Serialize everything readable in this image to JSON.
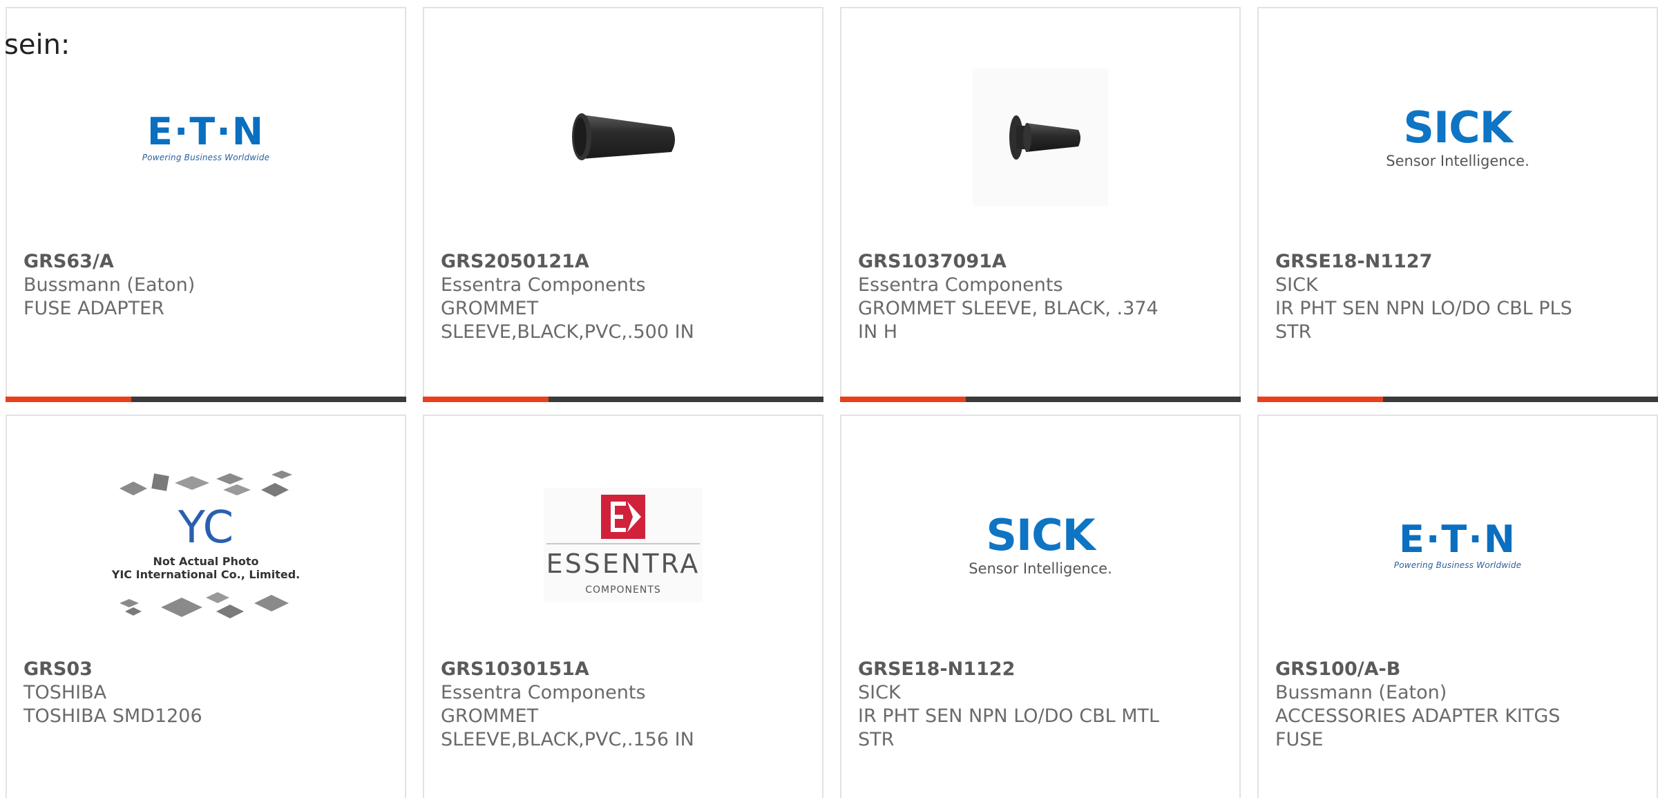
{
  "intro_text": "sein:",
  "colors": {
    "accent": "#e8401c",
    "bar": "#3b3b3b",
    "eaton_blue": "#0a6fc0",
    "sick_blue": "#0e74c4",
    "essentra_red": "#d0223a"
  },
  "products": [
    {
      "part": "GRS63/A",
      "manufacturer": "Bussmann (Eaton)",
      "description": "FUSE ADAPTER",
      "image": "eaton-logo",
      "logo": {
        "word": "E·T·N",
        "tag": "Powering Business Worldwide"
      }
    },
    {
      "part": "GRS2050121A",
      "manufacturer": "Essentra Components",
      "description_lines": [
        "GROMMET",
        "SLEEVE,BLACK,PVC,.500 IN"
      ],
      "image": "grommet-sleeve-photo"
    },
    {
      "part": "GRS1037091A",
      "manufacturer": "Essentra Components",
      "description_lines": [
        "GROMMET SLEEVE, BLACK, .374",
        "IN H"
      ],
      "image": "grommet-photo"
    },
    {
      "part": "GRSE18-N1127",
      "manufacturer": "SICK",
      "description_lines": [
        "IR PHT SEN NPN LO/DO CBL PLS",
        "STR"
      ],
      "image": "sick-logo",
      "logo": {
        "word": "SICK",
        "tag": "Sensor Intelligence."
      }
    },
    {
      "part": "GRS03",
      "manufacturer": "TOSHIBA",
      "description": "TOSHIBA SMD1206",
      "image": "yic-placeholder",
      "logo": {
        "mono": "YC",
        "line1": "Not Actual Photo",
        "line2": "YIC International Co., Limited."
      }
    },
    {
      "part": "GRS1030151A",
      "manufacturer": "Essentra Components",
      "description_lines": [
        "GROMMET",
        "SLEEVE,BLACK,PVC,.156 IN"
      ],
      "image": "essentra-logo",
      "logo": {
        "word": "ESSENTRA",
        "sub": "COMPONENTS"
      }
    },
    {
      "part": "GRSE18-N1122",
      "manufacturer": "SICK",
      "description_lines": [
        "IR PHT SEN NPN LO/DO CBL MTL",
        "STR"
      ],
      "image": "sick-logo",
      "logo": {
        "word": "SICK",
        "tag": "Sensor Intelligence."
      }
    },
    {
      "part": "GRS100/A-B",
      "manufacturer": "Bussmann (Eaton)",
      "description_lines": [
        "ACCESSORIES ADAPTER KITGS",
        "FUSE"
      ],
      "image": "eaton-logo",
      "logo": {
        "word": "E·T·N",
        "tag": "Powering Business Worldwide"
      }
    }
  ]
}
